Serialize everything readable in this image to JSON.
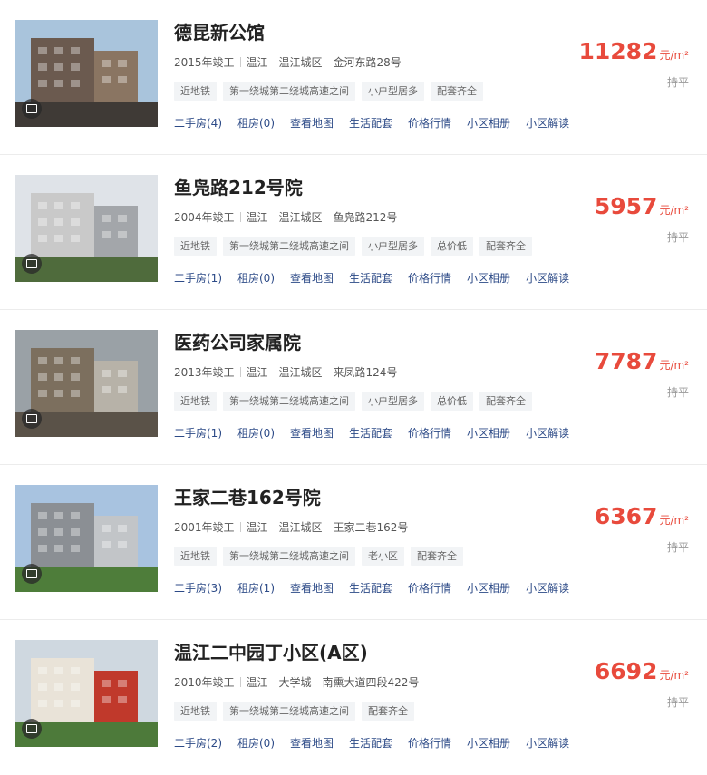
{
  "items": [
    {
      "name": "德昆新公馆",
      "year": "2015年竣工",
      "location": "温江 - 温江城区 - 金河东路28号",
      "tags": [
        "近地铁",
        "第一绕城第二绕城高速之间",
        "小户型居多",
        "配套齐全"
      ],
      "links": [
        "二手房(4)",
        "租房(0)",
        "查看地图",
        "生活配套",
        "价格行情",
        "小区相册",
        "小区解读"
      ],
      "price": "11282",
      "unit": "元/m²",
      "trend": "持平"
    },
    {
      "name": "鱼凫路212号院",
      "year": "2004年竣工",
      "location": "温江 - 温江城区 - 鱼凫路212号",
      "tags": [
        "近地铁",
        "第一绕城第二绕城高速之间",
        "小户型居多",
        "总价低",
        "配套齐全"
      ],
      "links": [
        "二手房(1)",
        "租房(0)",
        "查看地图",
        "生活配套",
        "价格行情",
        "小区相册",
        "小区解读"
      ],
      "price": "5957",
      "unit": "元/m²",
      "trend": "持平"
    },
    {
      "name": "医药公司家属院",
      "year": "2013年竣工",
      "location": "温江 - 温江城区 - 来凤路124号",
      "tags": [
        "近地铁",
        "第一绕城第二绕城高速之间",
        "小户型居多",
        "总价低",
        "配套齐全"
      ],
      "links": [
        "二手房(1)",
        "租房(0)",
        "查看地图",
        "生活配套",
        "价格行情",
        "小区相册",
        "小区解读"
      ],
      "price": "7787",
      "unit": "元/m²",
      "trend": "持平"
    },
    {
      "name": "王家二巷162号院",
      "year": "2001年竣工",
      "location": "温江 - 温江城区 - 王家二巷162号",
      "tags": [
        "近地铁",
        "第一绕城第二绕城高速之间",
        "老小区",
        "配套齐全"
      ],
      "links": [
        "二手房(3)",
        "租房(1)",
        "查看地图",
        "生活配套",
        "价格行情",
        "小区相册",
        "小区解读"
      ],
      "price": "6367",
      "unit": "元/m²",
      "trend": "持平"
    },
    {
      "name": "温江二中园丁小区(A区)",
      "year": "2010年竣工",
      "location": "温江 - 大学城 - 南熏大道四段422号",
      "tags": [
        "近地铁",
        "第一绕城第二绕城高速之间",
        "配套齐全"
      ],
      "links": [
        "二手房(2)",
        "租房(0)",
        "查看地图",
        "生活配套",
        "价格行情",
        "小区相册",
        "小区解读"
      ],
      "price": "6692",
      "unit": "元/m²",
      "trend": "持平"
    }
  ]
}
